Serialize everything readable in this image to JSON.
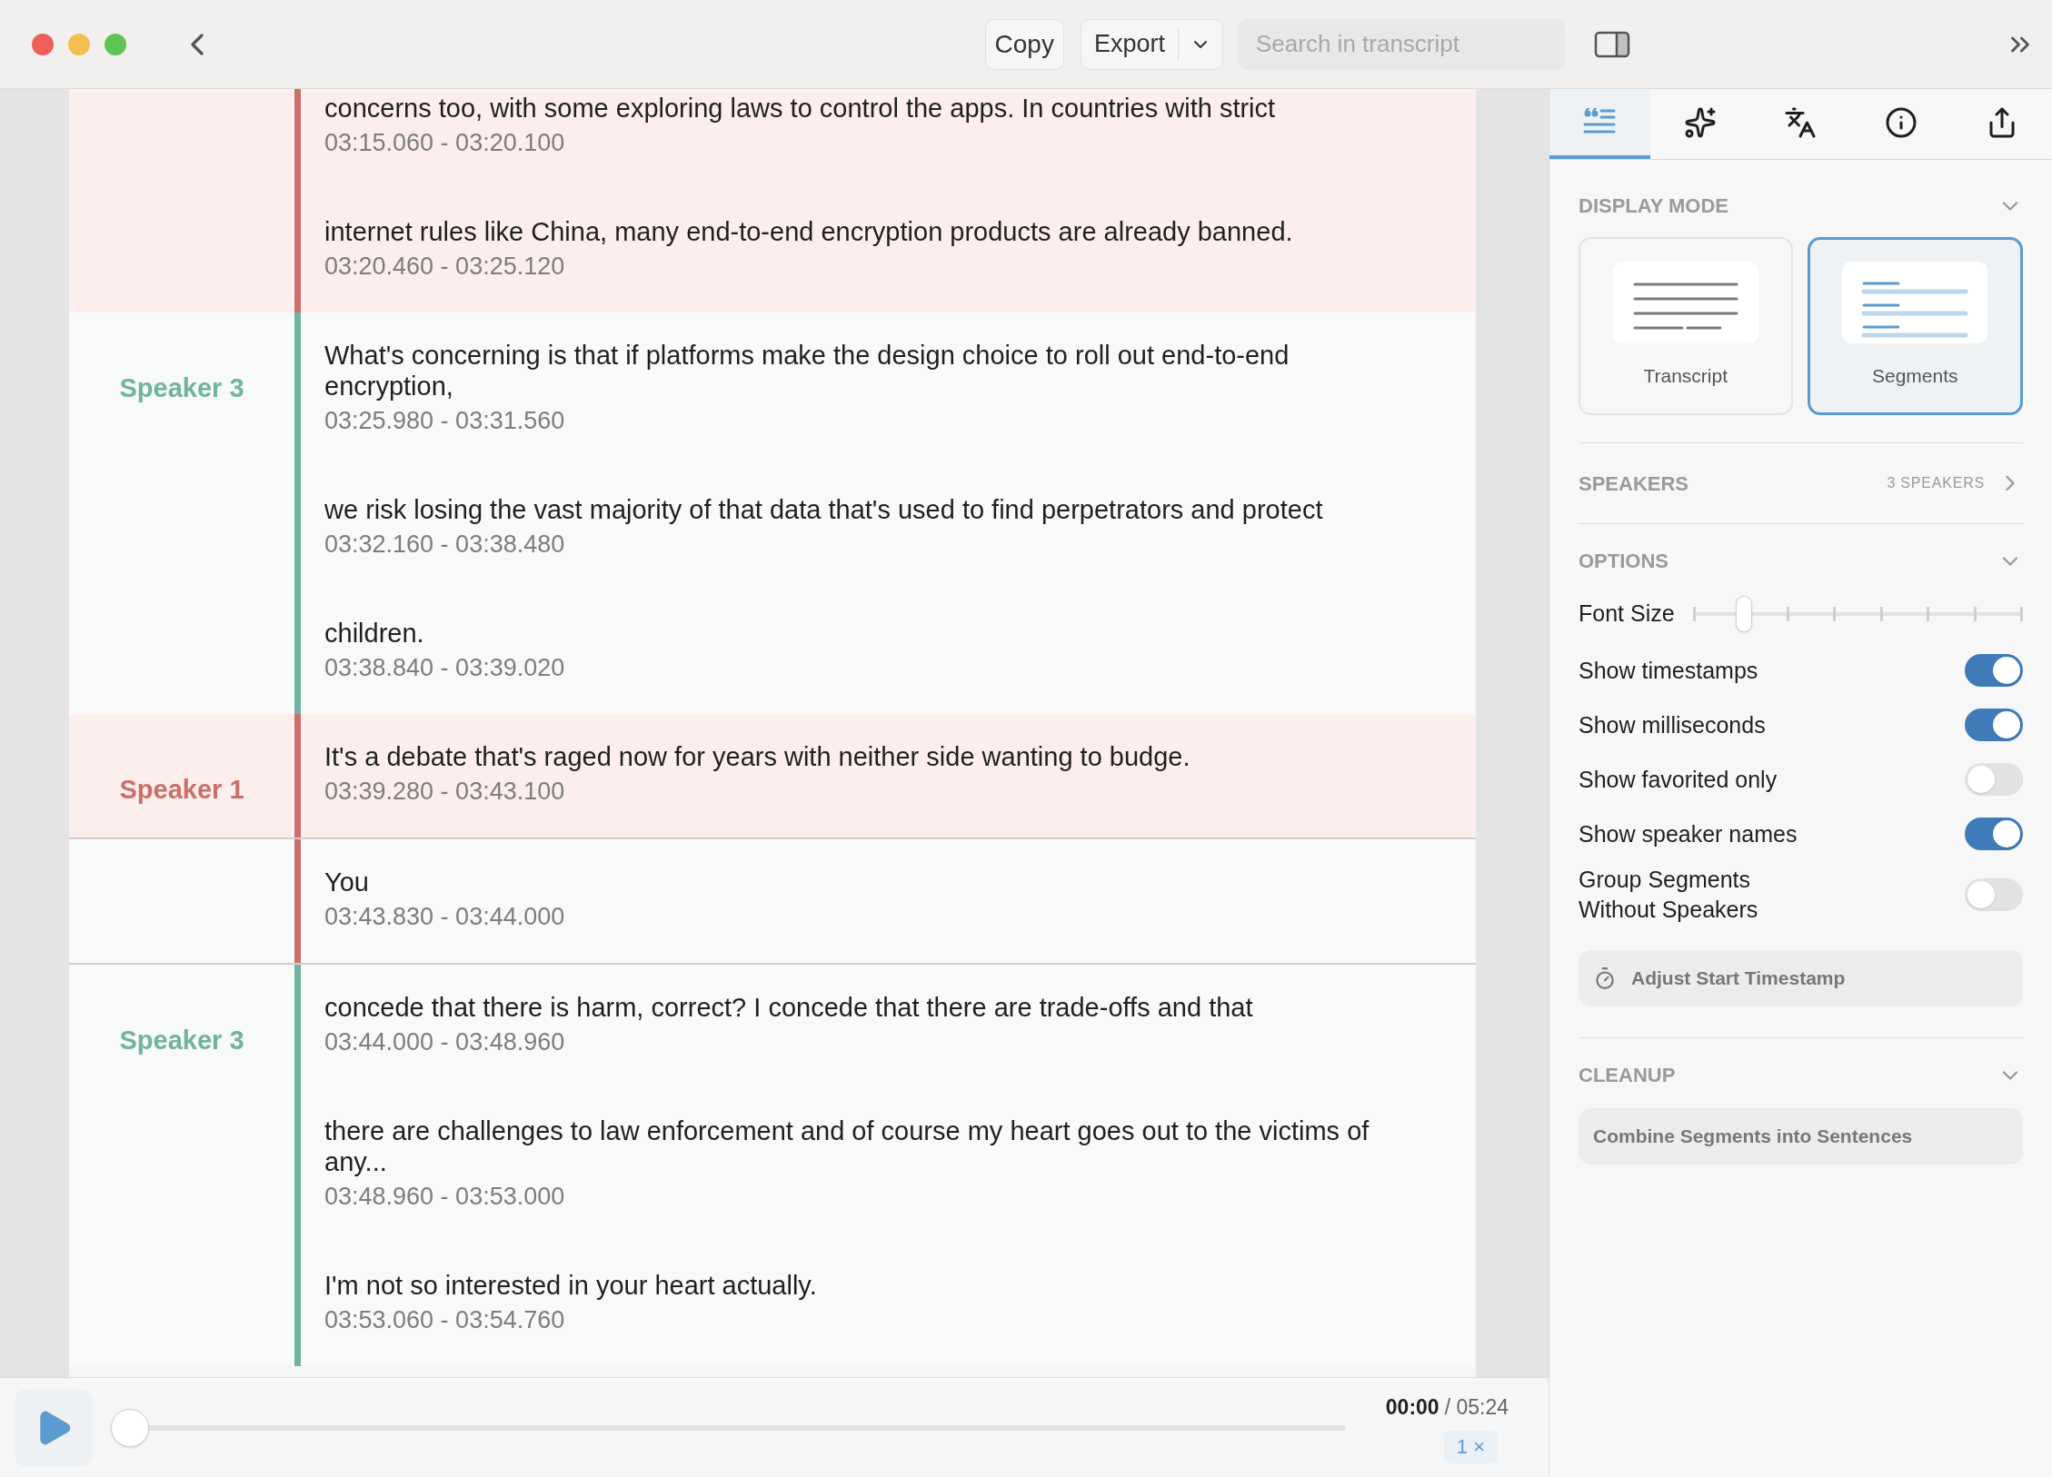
{
  "toolbar": {
    "copy": "Copy",
    "export": "Export",
    "search_placeholder": "Search in transcript"
  },
  "transcript": {
    "groups": [
      {
        "color": "#c9706b",
        "highlighted": true,
        "boxed": false,
        "segments": [
          {
            "text": "concerns too, with some exploring laws to control the apps. In countries with strict",
            "time": "03:15.060 - 03:20.100"
          },
          {
            "text": "internet rules like China, many end-to-end encryption products are already banned.",
            "time": "03:20.460 - 03:25.120"
          }
        ]
      },
      {
        "speaker": "Speaker 3",
        "color": "#6fb3a0",
        "highlighted": false,
        "boxed": false,
        "segments": [
          {
            "text": "What's concerning is that if platforms make the design choice to roll out end-to-end encryption,",
            "time": "03:25.980 - 03:31.560"
          },
          {
            "text": "we risk losing the vast majority of that data that's used to find perpetrators and protect",
            "time": "03:32.160 - 03:38.480"
          },
          {
            "text": "children.",
            "time": "03:38.840 - 03:39.020"
          }
        ]
      },
      {
        "speaker": "Speaker 1",
        "color": "#c9706b",
        "highlighted": true,
        "boxed": false,
        "segments": [
          {
            "text": "It's a debate that's raged now for years with neither side wanting to budge.",
            "time": "03:39.280 - 03:43.100"
          }
        ]
      },
      {
        "color": "#c9706b",
        "highlighted": false,
        "boxed": true,
        "segments": [
          {
            "text": "You",
            "time": "03:43.830 - 03:44.000"
          }
        ]
      },
      {
        "speaker": "Speaker 3",
        "color": "#6fb3a0",
        "highlighted": false,
        "boxed": false,
        "segments": [
          {
            "text": "concede that there is harm, correct? I concede that there are trade-offs and that",
            "time": "03:44.000 - 03:48.960"
          },
          {
            "text": "there are challenges to law enforcement and of course my heart goes out to the victims of any...",
            "time": "03:48.960 - 03:53.000"
          },
          {
            "text": "I'm not so interested in your heart actually.",
            "time": "03:53.060 - 03:54.760"
          }
        ]
      }
    ]
  },
  "player": {
    "progress": {
      "level": 0
    },
    "current_time": "00:00",
    "duration": "/ 05:24",
    "speed": "1 ×"
  },
  "sidebar": {
    "tabs": [
      {
        "kind": "transcript",
        "selected": true
      },
      {
        "kind": "ai",
        "selected": false
      },
      {
        "kind": "translate",
        "selected": false
      },
      {
        "kind": "info",
        "selected": false
      },
      {
        "kind": "share",
        "selected": false
      }
    ],
    "display_mode": {
      "title": "DISPLAY MODE",
      "options": [
        {
          "kind": "transcript",
          "label": "Transcript",
          "selected": false
        },
        {
          "kind": "segments",
          "label": "Segments",
          "selected": true
        }
      ]
    },
    "speakers": {
      "title": "SPEAKERS",
      "count": "3 SPEAKERS"
    },
    "options": {
      "title": "OPTIONS",
      "font_size": {
        "label": "Font Size",
        "level": 0.155
      },
      "toggles": [
        {
          "label": "Show timestamps",
          "on": true
        },
        {
          "label": "Show milliseconds",
          "on": true
        },
        {
          "label": "Show favorited only",
          "on": false
        },
        {
          "label": "Show speaker names",
          "on": true
        },
        {
          "label": "Group Segments Without Speakers",
          "on": false
        }
      ],
      "adjust_button": "Adjust Start Timestamp"
    },
    "cleanup": {
      "title": "CLEANUP",
      "button": "Combine Segments into Sentences"
    }
  }
}
